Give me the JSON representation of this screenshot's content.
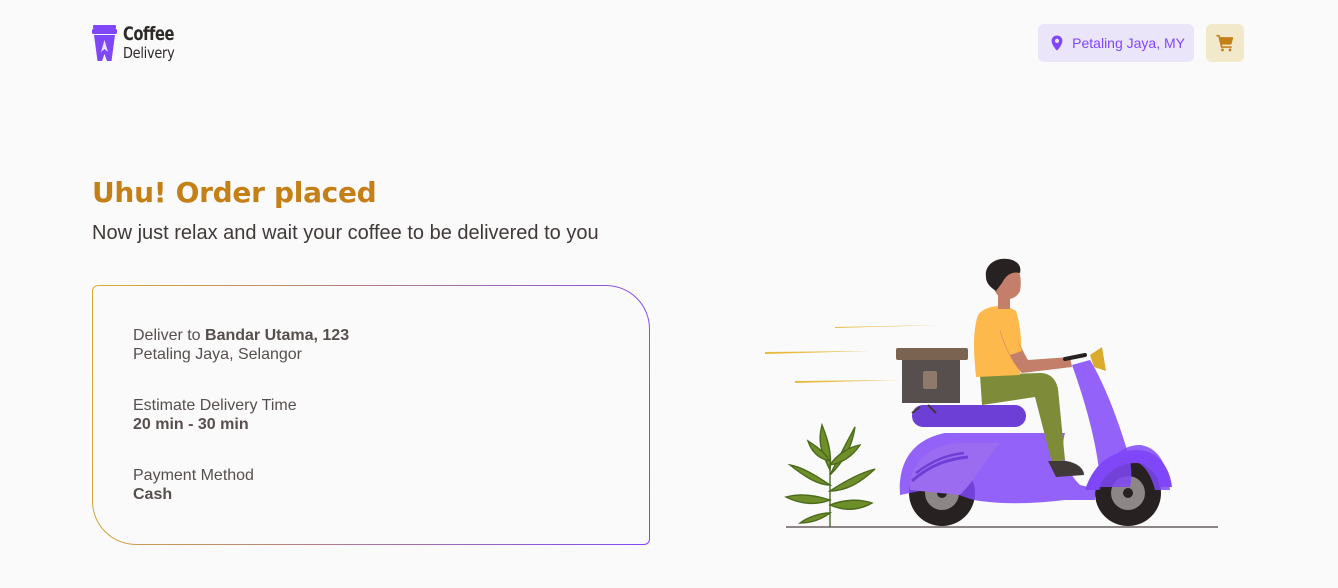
{
  "header": {
    "logo": {
      "line1": "Coffee",
      "line2": "Delivery",
      "icon": "coffee-cup-icon"
    },
    "location": {
      "icon": "map-pin-icon",
      "label": "Petaling Jaya, MY"
    },
    "cart": {
      "icon": "shopping-cart-icon"
    }
  },
  "main": {
    "title": "Uhu! Order placed",
    "subtitle": "Now just relax and wait your coffee to be delivered to you"
  },
  "order": {
    "deliver_prefix": "Deliver to ",
    "deliver_address": "Bandar Utama, 123",
    "deliver_city": "Petaling Jaya, Selangor",
    "time_label": "Estimate Delivery Time",
    "time_value": "20 min - 30 min",
    "payment_label": "Payment Method",
    "payment_value": "Cash"
  },
  "illustration": {
    "icon": "delivery-scooter-illustration"
  },
  "colors": {
    "background": "#FAFAFA",
    "title": "#C47F17",
    "purple": "#8047F8",
    "purple_light": "#EBE5F9",
    "yellow_light": "#F1E9C9",
    "yellow_dark": "#C47F17",
    "card_gradient_start": "#DBAC2C",
    "card_gradient_end": "#8047F8"
  }
}
